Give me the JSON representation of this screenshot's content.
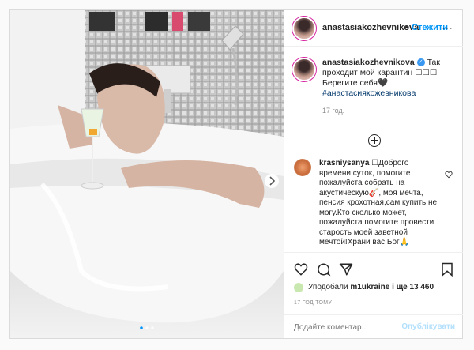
{
  "header": {
    "username": "anastasiakozhevnikova",
    "separator": "•",
    "follow_label": "Стежити",
    "more_icon": "⋯"
  },
  "caption": {
    "username": "anastasiakozhevnikova",
    "verified_icon": "✓",
    "text": "Так проходит мой карантин ☐☐☐ Берегите себя🖤",
    "hashtag": "#анастасиякожевникова",
    "time": "17 год."
  },
  "comment": {
    "username": "krasniysanya",
    "text": "☐Доброго времени суток, помогите пожалуйста собрать на акустическую🎸, моя мечта, пенсия крохотная,сам купить не могу.Кто сколько может, пожалуйста помогите провести старость моей заветной мечтой!Храни вас Бог🙏"
  },
  "likes": {
    "prefix": "Уподобали",
    "user": "m1ukraine",
    "suffix": " і ще 13 460"
  },
  "timestamp": "17 ГОД ТОМУ",
  "add_comment": {
    "placeholder": "Додайте коментар...",
    "publish_label": "Опублікувати"
  },
  "colors": {
    "accent": "#0095f6",
    "text": "#262626",
    "muted": "#8e8e8e"
  }
}
